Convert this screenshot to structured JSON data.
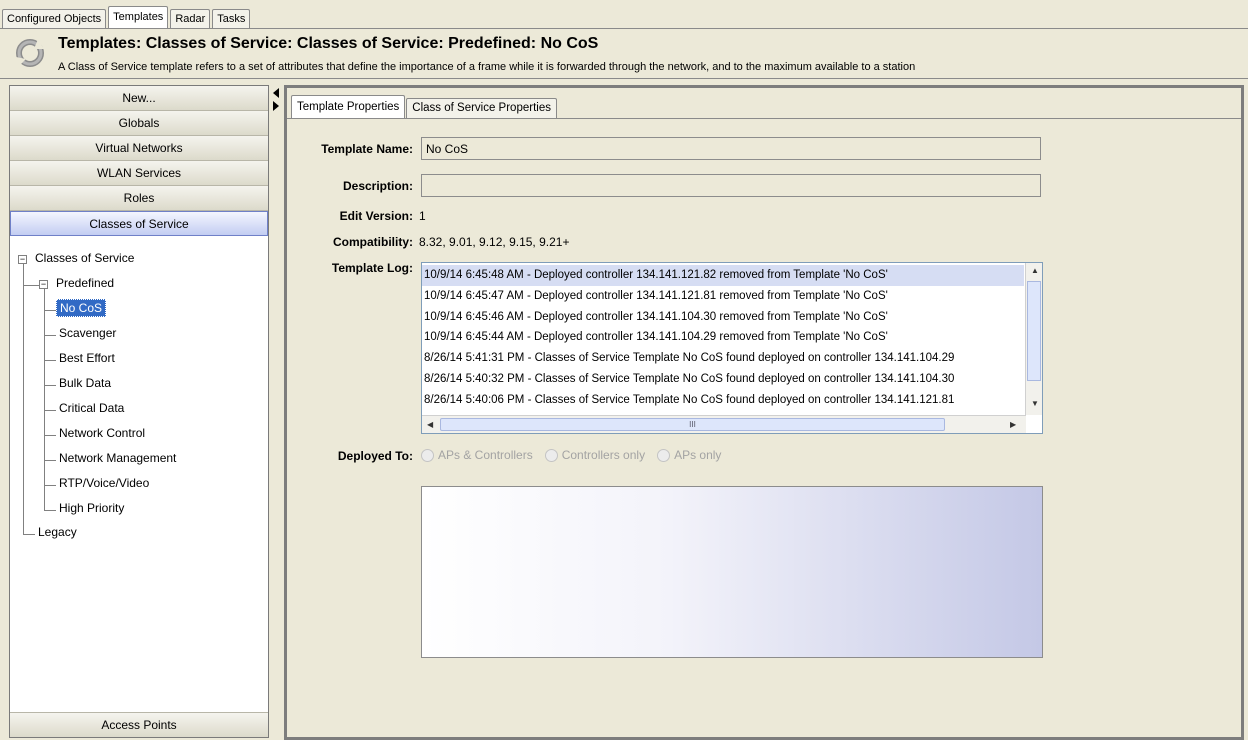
{
  "top_tabs": [
    "Configured Objects",
    "Templates",
    "Radar",
    "Tasks"
  ],
  "header": {
    "title": "Templates: Classes of Service: Classes of Service: Predefined: No CoS",
    "description": "A Class of Service template refers to a set of attributes that define the importance of a frame while it is forwarded through the network, and to the maximum available to a station"
  },
  "sidebar": {
    "buttons": [
      "New...",
      "Globals",
      "Virtual Networks",
      "WLAN Services",
      "Roles",
      "Classes of Service"
    ],
    "bottom_button": "Access Points",
    "tree": {
      "root": "Classes of Service",
      "predefined": "Predefined",
      "items": [
        "No CoS",
        "Scavenger",
        "Best Effort",
        "Bulk Data",
        "Critical Data",
        "Network Control",
        "Network Management",
        "RTP/Voice/Video",
        "High Priority"
      ],
      "legacy": "Legacy",
      "expanded_glyph": "−"
    }
  },
  "main": {
    "tabs": [
      "Template Properties",
      "Class of Service Properties"
    ],
    "labels": {
      "template_name": "Template Name:",
      "description": "Description:",
      "edit_version": "Edit Version:",
      "compatibility": "Compatibility:",
      "template_log": "Template Log:",
      "deployed_to": "Deployed To:"
    },
    "template_name_value": "No CoS",
    "description_value": "",
    "edit_version_value": "1",
    "compatibility_value": "8.32, 9.01, 9.12, 9.15, 9.21+",
    "log": [
      "10/9/14 6:45:48 AM - Deployed controller 134.141.121.82 removed from Template 'No CoS'",
      "10/9/14 6:45:47 AM - Deployed controller 134.141.121.81 removed from Template 'No CoS'",
      "10/9/14 6:45:46 AM - Deployed controller 134.141.104.30 removed from Template 'No CoS'",
      "10/9/14 6:45:44 AM - Deployed controller 134.141.104.29 removed from Template 'No CoS'",
      "8/26/14 5:41:31 PM - Classes of Service Template No CoS found deployed on controller 134.141.104.29",
      "8/26/14 5:40:32 PM - Classes of Service Template No CoS found deployed on controller 134.141.104.30",
      "8/26/14 5:40:06 PM - Classes of Service Template No CoS found deployed on controller 134.141.121.81"
    ],
    "scroll_grip": "III",
    "deployed_options": [
      "APs & Controllers",
      "Controllers only",
      "APs only"
    ]
  },
  "colors": {
    "background": "#ece9d8",
    "selection": "#316ac5",
    "active_button": "#c3cdf2"
  }
}
